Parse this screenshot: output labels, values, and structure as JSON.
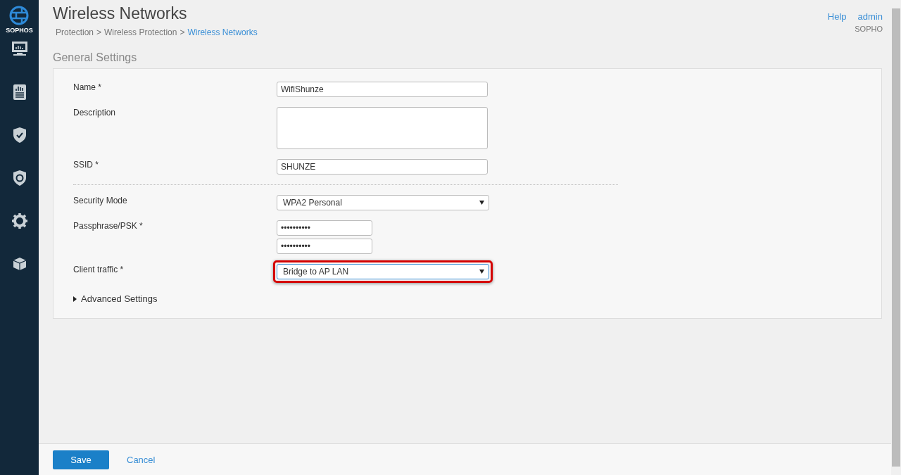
{
  "sidebar": {
    "logo_text": "SOPHOS",
    "items": [
      {
        "kind": "monitor"
      },
      {
        "kind": "report"
      },
      {
        "kind": "shield"
      },
      {
        "kind": "protect"
      },
      {
        "kind": "gear"
      },
      {
        "kind": "box"
      }
    ]
  },
  "header": {
    "title": "Wireless Networks",
    "breadcrumb": [
      "Protection",
      "Wireless Protection",
      "Wireless Networks"
    ],
    "separator": ">",
    "help": "Help",
    "user": "admin",
    "appliance": "SOPHO"
  },
  "section_title": "General Settings",
  "form": [
    {
      "kind": "text",
      "label": "Name *",
      "value": "WifiShunze"
    },
    {
      "kind": "textarea",
      "label": "Description"
    },
    {
      "kind": "text",
      "label": "SSID *",
      "value": "SHUNZE"
    },
    {
      "kind": "divider"
    },
    {
      "kind": "select",
      "label": "Security Mode",
      "value": "WPA2 Personal",
      "highlighted": false
    },
    {
      "kind": "password",
      "label": "Passphrase/PSK *",
      "values": [
        "••••••••••",
        "••••••••••"
      ]
    },
    {
      "kind": "select",
      "label": "Client traffic *",
      "value": "Bridge to AP LAN",
      "highlighted": true
    },
    {
      "kind": "expander",
      "label": "Advanced Settings",
      "expanded": false
    }
  ],
  "footer": {
    "save": "Save",
    "cancel": "Cancel"
  }
}
